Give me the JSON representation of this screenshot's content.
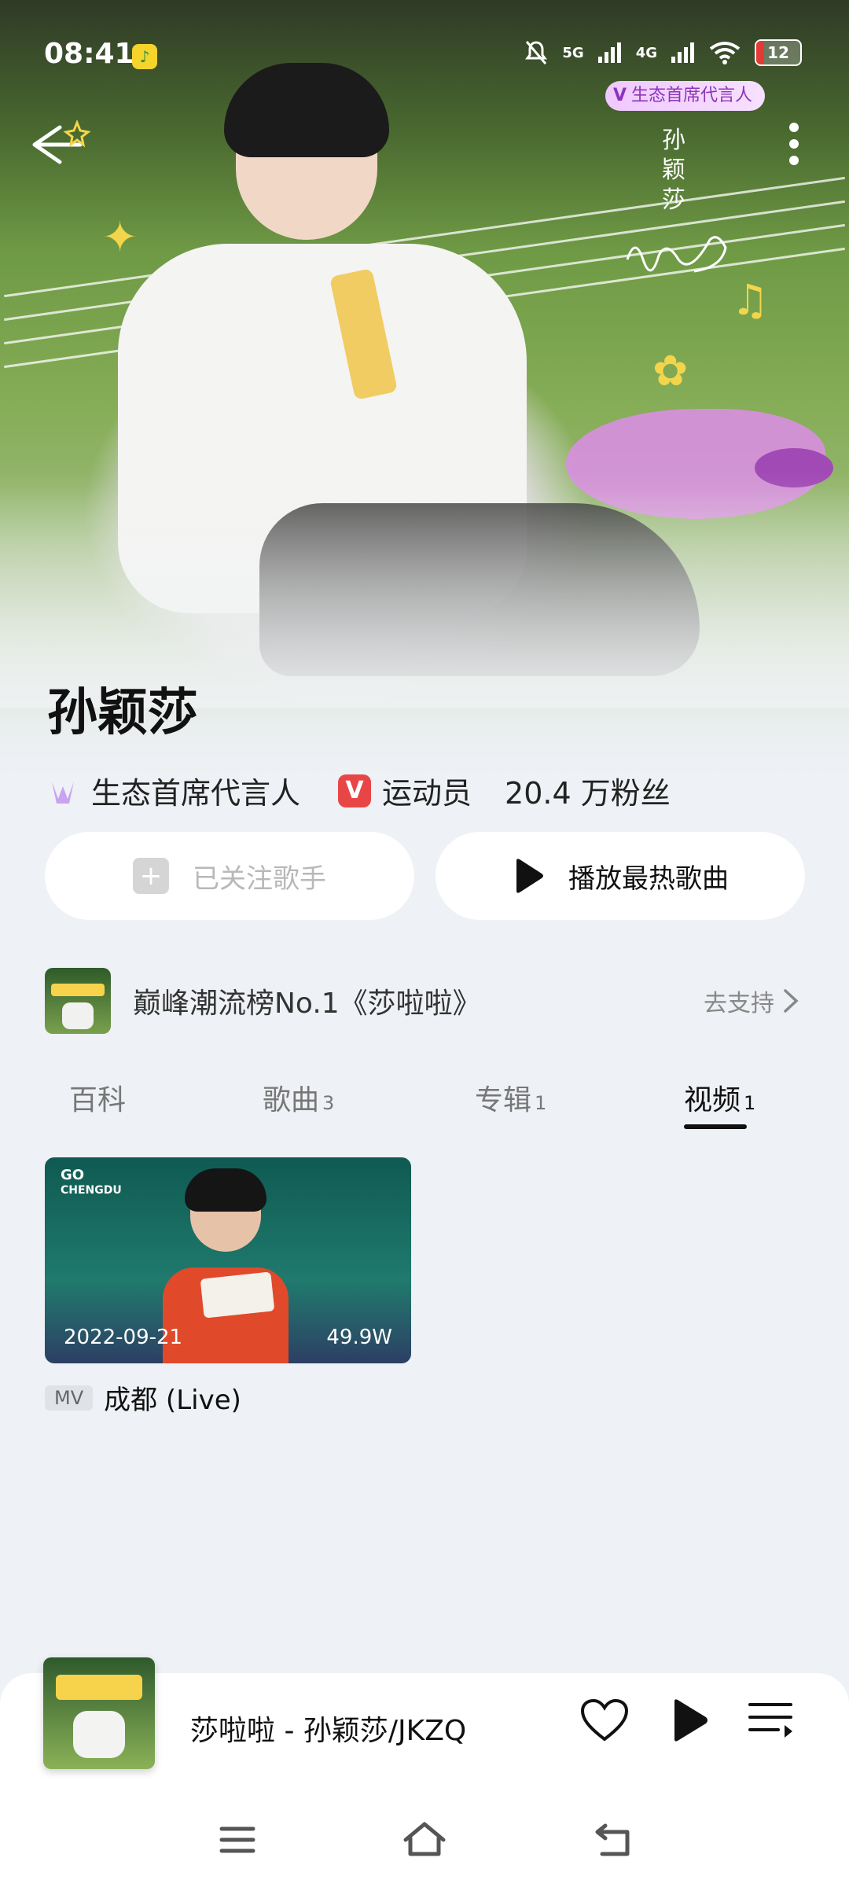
{
  "status_bar": {
    "time": "08:41",
    "network_1": "5G",
    "network_2": "4G",
    "battery": "12"
  },
  "header": {
    "spokesperson_badge": "生态首席代言人",
    "signature_name": "孙颖莎"
  },
  "artist": {
    "name": "孙颖莎",
    "tag_1": "生态首席代言人",
    "tag_2_badge": "V",
    "tag_2": "运动员",
    "fans": "20.4 万粉丝"
  },
  "actions": {
    "follow_label": "已关注歌手",
    "play_label": "播放最热歌曲"
  },
  "ranking": {
    "text": "巅峰潮流榜No.1《莎啦啦》",
    "link": "去支持"
  },
  "tabs": [
    {
      "label": "百科",
      "count": ""
    },
    {
      "label": "歌曲",
      "count": "3"
    },
    {
      "label": "专辑",
      "count": "1"
    },
    {
      "label": "视频",
      "count": "1"
    }
  ],
  "active_tab": "视频",
  "videos": [
    {
      "thumb_logo_1": "GO",
      "thumb_logo_2": "CHENGDU",
      "date": "2022-09-21",
      "views": "49.9W",
      "tag": "MV",
      "title": "成都 (Live)"
    }
  ],
  "player": {
    "title": "莎啦啦 - 孙颖莎/JKZQ"
  },
  "colors": {
    "background": "#eef1f5",
    "accent_red": "#e84646",
    "badge_purple": "#8a35b8"
  },
  "icons": [
    "back-arrow-icon",
    "more-vertical-icon",
    "plus-icon",
    "play-icon",
    "chevron-right-icon",
    "heart-icon",
    "playlist-icon",
    "menu-icon",
    "home-icon",
    "return-icon"
  ]
}
